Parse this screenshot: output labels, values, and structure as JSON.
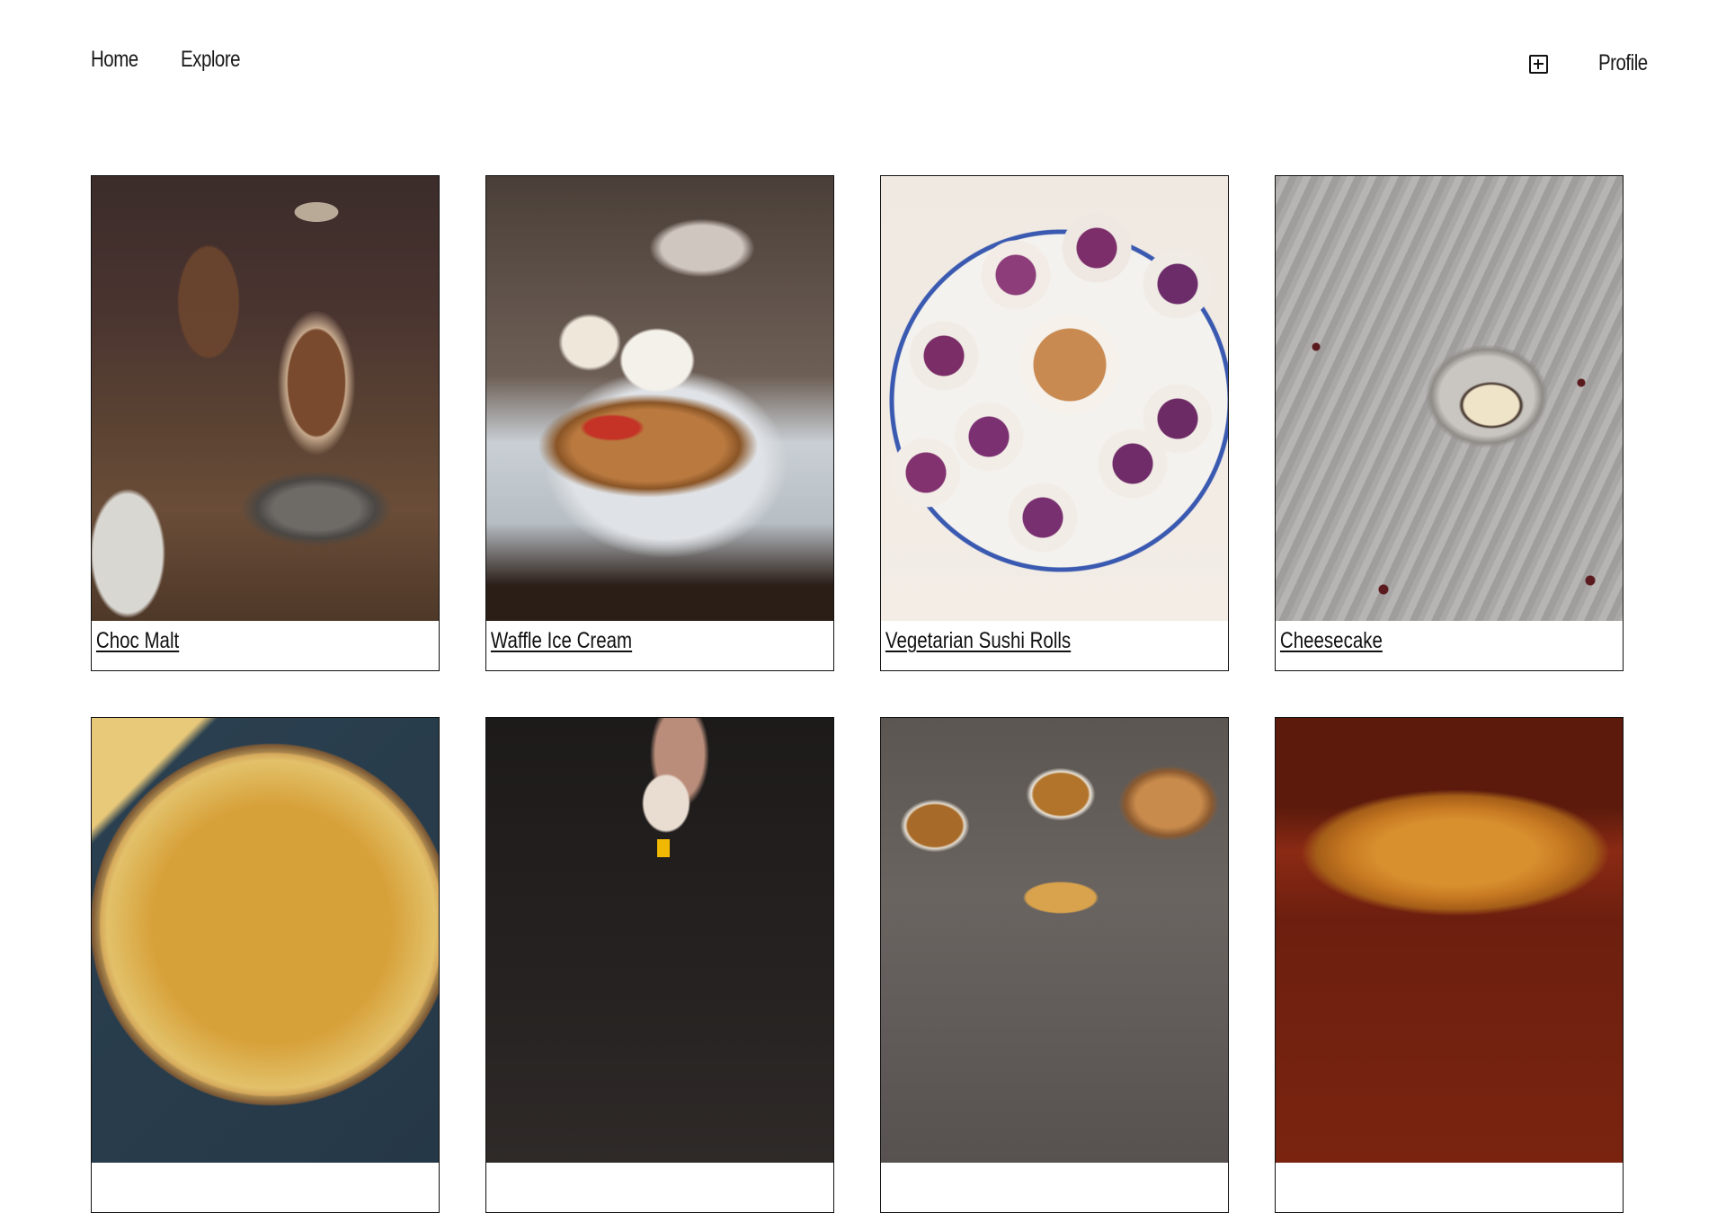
{
  "nav": {
    "home": "Home",
    "explore": "Explore",
    "profile": "Profile",
    "add_icon": "plus-square-icon"
  },
  "recipes": [
    {
      "title": "Choc Malt"
    },
    {
      "title": "Waffle Ice Cream"
    },
    {
      "title": "Vegetarian Sushi Rolls"
    },
    {
      "title": "Cheesecake"
    },
    {
      "title": ""
    },
    {
      "title": ""
    },
    {
      "title": ""
    },
    {
      "title": ""
    }
  ],
  "colors": {
    "border": "#111111",
    "background": "#ffffff",
    "text": "#111111"
  }
}
